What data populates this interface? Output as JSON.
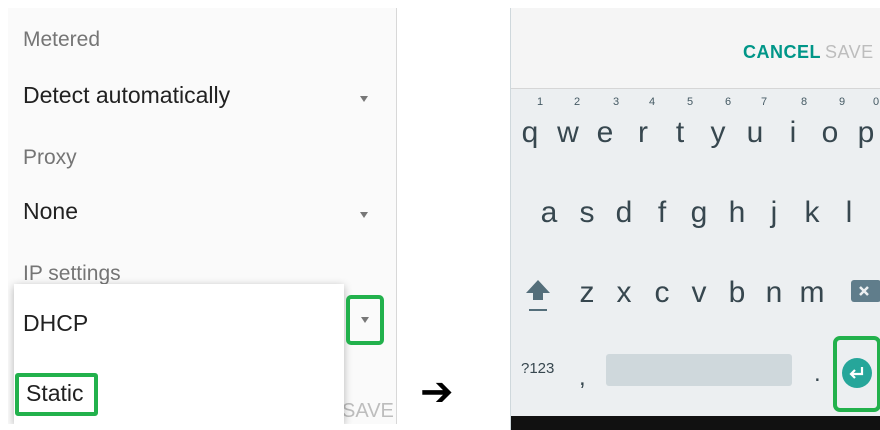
{
  "left": {
    "metered_label": "Metered",
    "metered_value": "Detect automatically",
    "proxy_label": "Proxy",
    "proxy_value": "None",
    "ip_label": "IP settings",
    "bg_save_label": "SAVE",
    "dropdown": {
      "options": [
        "DHCP",
        "Static"
      ],
      "highlighted": "Static"
    }
  },
  "arrow": "➔",
  "right": {
    "cancel_label": "CANCEL",
    "save_label": "SAVE",
    "keyboard": {
      "row1": [
        "q",
        "w",
        "e",
        "r",
        "t",
        "y",
        "u",
        "i",
        "o",
        "p"
      ],
      "row1_hints": [
        "1",
        "2",
        "3",
        "4",
        "5",
        "6",
        "7",
        "8",
        "9",
        "0"
      ],
      "row2": [
        "a",
        "s",
        "d",
        "f",
        "g",
        "h",
        "j",
        "k",
        "l"
      ],
      "row3": [
        "z",
        "x",
        "c",
        "v",
        "b",
        "n",
        "m"
      ],
      "symbols_label": "?123",
      "comma": ",",
      "period": ".",
      "icons": [
        "shift-icon",
        "backspace-icon",
        "enter-icon"
      ]
    }
  },
  "colors": {
    "highlight": "#22b14c",
    "accent": "#009688",
    "enter": "#26a69a"
  }
}
